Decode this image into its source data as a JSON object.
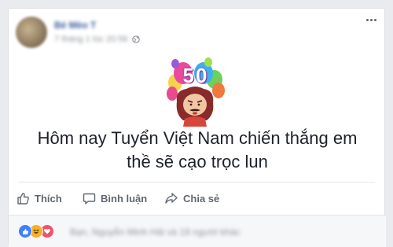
{
  "post": {
    "author_name": "Bé Mèo T",
    "timestamp": "7 tháng 1 lúc 20:56",
    "audience_icon": "globe-icon",
    "menu_icon": "more-dots-icon",
    "sticker": {
      "number": "50",
      "icon": "celebration-sticker"
    },
    "text_lines": [
      "Hôm nay Tuyển Việt Nam chiến thắng em",
      "thề sẽ cạo trọc lun"
    ]
  },
  "actions": {
    "like": {
      "label": "Thích",
      "icon": "thumbs-up-icon"
    },
    "comment": {
      "label": "Bình luận",
      "icon": "speech-bubble-icon"
    },
    "share": {
      "label": "Chia sẻ",
      "icon": "share-arrow-icon"
    }
  },
  "reactions": {
    "icons": [
      "like-reaction-icon",
      "haha-reaction-icon",
      "love-reaction-icon"
    ],
    "summary": "Bạn, Nguyễn Minh Hải và 18 người khác"
  },
  "colors": {
    "link": "#365899",
    "text": "#1d2129",
    "muted": "#606770",
    "like": "#4080ff",
    "haha": "#f7b125",
    "love": "#f25268"
  }
}
